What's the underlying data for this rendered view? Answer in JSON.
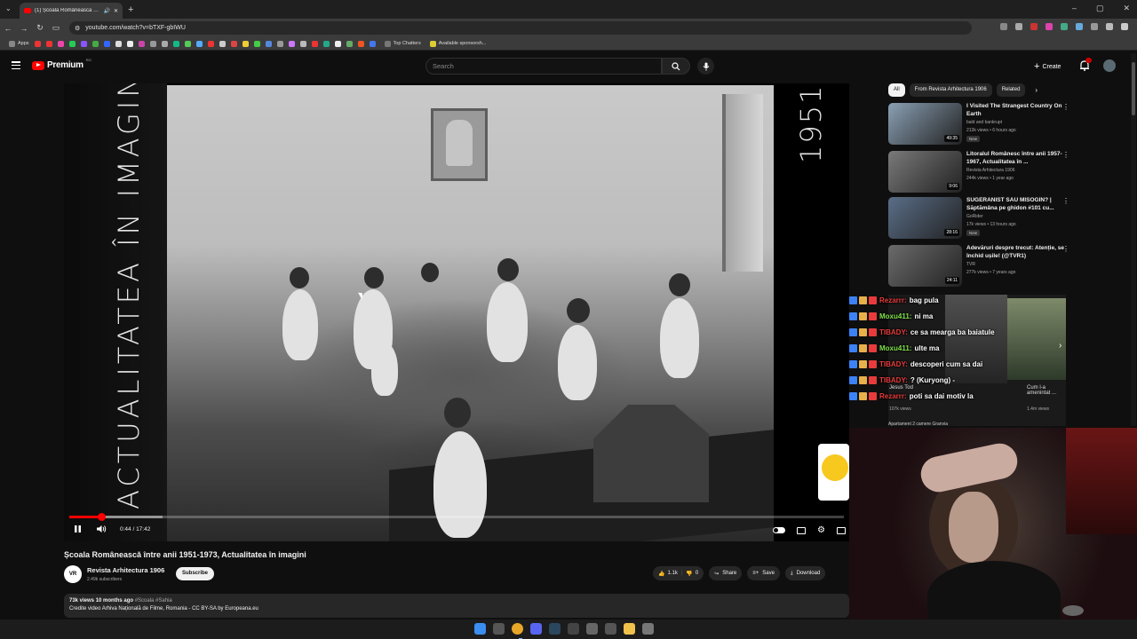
{
  "browser": {
    "tab_title": "(1) Școala Românească într...",
    "url": "youtube.com/watch?v=bTXF-gbIWU",
    "bookmarks": {
      "apps_label": "Apps",
      "top_chatters": "Top Chatters",
      "sponsorship": "Available sponsorsh..."
    }
  },
  "yt_header": {
    "logo_text": "Premium",
    "logo_sup": "RO",
    "search_placeholder": "Search",
    "create_label": "Create"
  },
  "player": {
    "overlay_vertical_text": "ACTUALITATEA ÎN IMAGINI",
    "overlay_year": "1951",
    "time_display": "0:44 / 17:42",
    "progress_fraction": 0.041,
    "buffer_fraction": 0.12
  },
  "video": {
    "title": "Școala Românească între anii 1951-1973, Actualitatea în imagini",
    "channel_initials": "VR",
    "channel_name": "Revista Arhitectura 1906",
    "subscribers": "2.49k subscribers",
    "subscribe_label": "Subscribe",
    "likes": "1.1k",
    "dislikes": "0",
    "share_label": "Share",
    "save_label": "Save",
    "download_label": "Download",
    "description": {
      "meta": "73k views  10 months ago",
      "tags": "#Scoala #Sahia",
      "line1": "Credite video Arhiva Națională de Filme, Romania - CC BY-SA by Europeana.eu"
    }
  },
  "sidebar": {
    "chips": [
      "All",
      "From Revista Arhitectura 1906",
      "Related"
    ],
    "recommendations": [
      {
        "title": "I Visited The Strangest Country On Earth",
        "channel": "bald and bankrupt",
        "stats": "213k views • 6 hours ago",
        "duration": "49:35",
        "badge": "New",
        "thumb_color": "#8aa0b4"
      },
      {
        "title": "Litoralul Românesc între anii 1957-1967, Actualitatea în ...",
        "channel": "Revista Arhitectura 1906",
        "stats": "244k views • 1 year ago",
        "duration": "9:06",
        "badge": "",
        "thumb_color": "#7a7a7a"
      },
      {
        "title": "SUGERANIST SAU MISOGIN? | Săptămâna pe ghidon #101 cu...",
        "channel": "GoRider",
        "stats": "17k views • 13 hours ago",
        "duration": "28:16",
        "badge": "New",
        "thumb_color": "#5a6e88"
      },
      {
        "title": "Adevăruri despre trecut: Atenție, se închid ușile! (@TVR1)",
        "channel": "TVR",
        "stats": "277k views • 7 years ago",
        "duration": "24:11",
        "badge": "",
        "thumb_color": "#6b6b6b"
      }
    ]
  },
  "chat": {
    "lines": [
      {
        "user": "Rezarrr:",
        "msg": "bag pula",
        "color": "red"
      },
      {
        "user": "Moxu411:",
        "msg": "ni ma",
        "color": "green"
      },
      {
        "user": "TIBADY:",
        "msg": "ce sa mearga ba baiatule",
        "color": "red"
      },
      {
        "user": "Moxu411:",
        "msg": "ulte ma",
        "color": "green"
      },
      {
        "user": "TIBADY:",
        "msg": "descoperi cum sa dai",
        "color": "red"
      },
      {
        "user": "TIBADY:",
        "msg": "? (Kuryong) -",
        "color": "red"
      },
      {
        "user": "Rezarrr:",
        "msg": "poti sa dai motiv la",
        "color": "red"
      }
    ],
    "overlap_texts": [
      "Jesus Tod",
      "Cum l-a amenintat ...",
      "107k views",
      "1.4m views",
      "Apartament 2 camere Granvia"
    ]
  },
  "colors": {
    "accent_red": "#ff0000",
    "bg": "#0f0f0f",
    "chat_green": "#7fe24a",
    "chat_red": "#e83b3b"
  }
}
